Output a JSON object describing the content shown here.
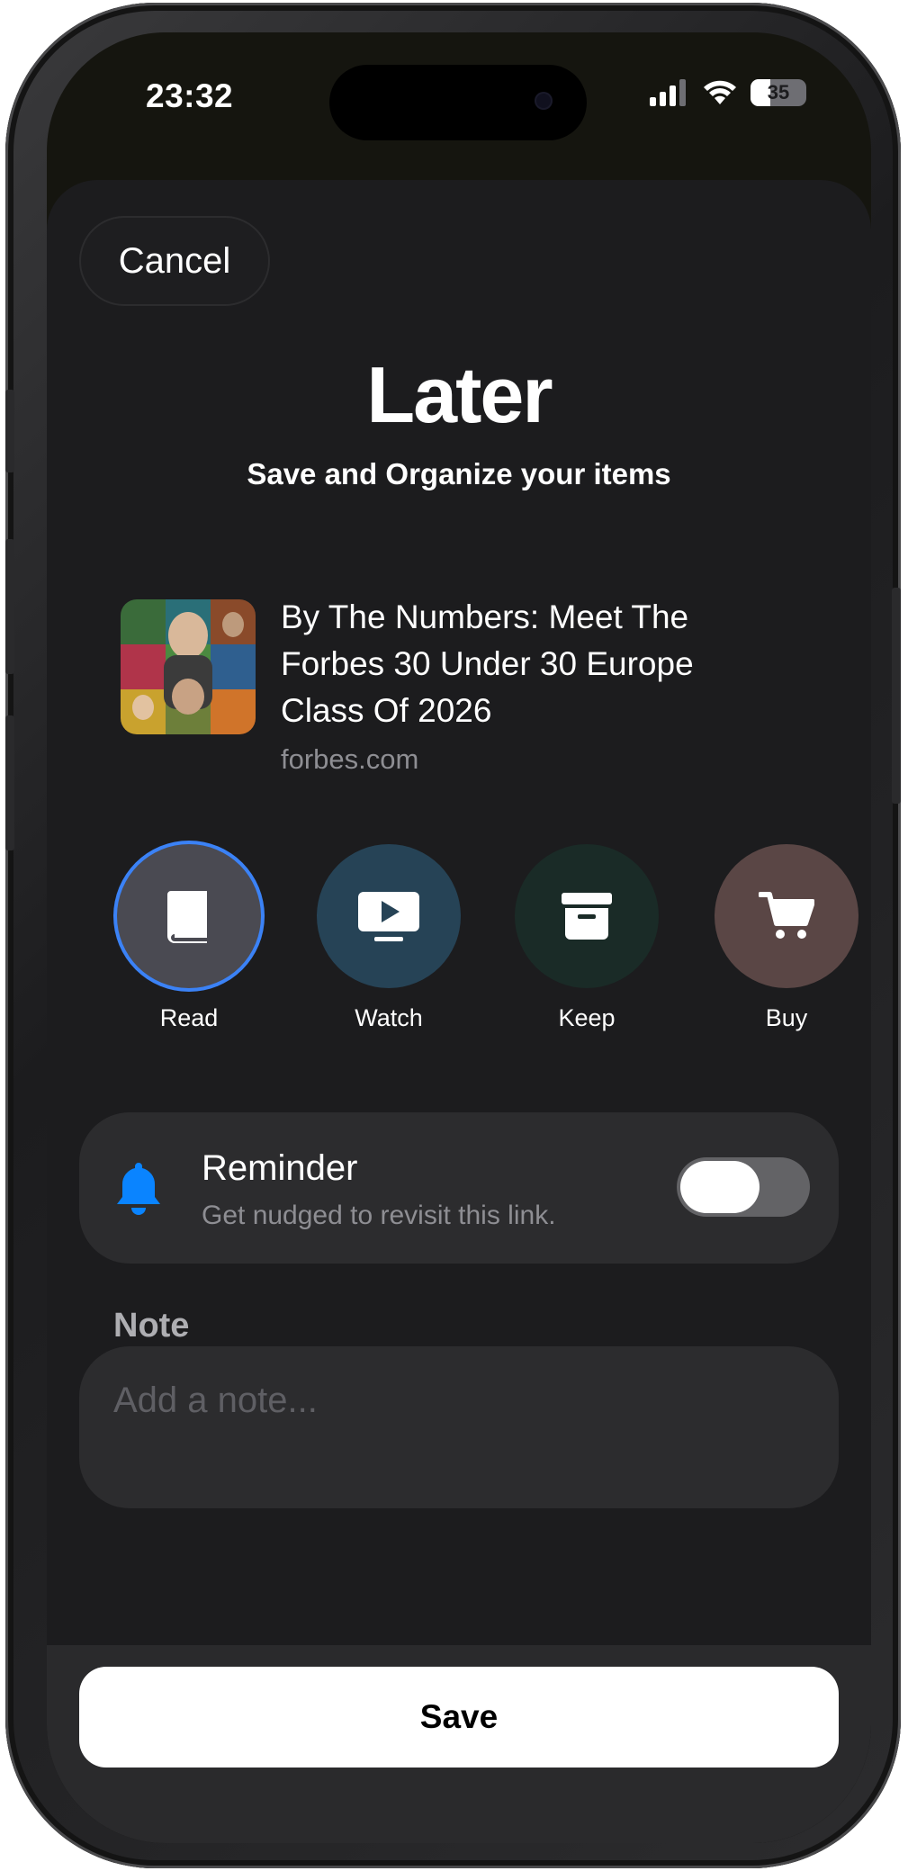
{
  "status_bar": {
    "time": "23:32",
    "battery": "35",
    "battery_level": 0.35
  },
  "sheet": {
    "cancel_label": "Cancel",
    "app_title": "Later",
    "subtitle": "Save and Organize your items"
  },
  "article": {
    "title": "By The Numbers: Meet The Forbes 30 Under 30 Europe Class Of 2026",
    "source": "forbes.com"
  },
  "categories": [
    {
      "label": "Read",
      "icon": "book-icon",
      "color": "#4a4a52",
      "selected": true
    },
    {
      "label": "Watch",
      "icon": "play-screen-icon",
      "color": "#264356"
    },
    {
      "label": "Keep",
      "icon": "archive-box-icon",
      "color": "#1a2b27"
    },
    {
      "label": "Buy",
      "icon": "cart-icon",
      "color": "#5a4645"
    }
  ],
  "reminder": {
    "title": "Reminder",
    "subtitle": "Get nudged to revisit this link.",
    "enabled": false,
    "bell_color": "#0a84ff"
  },
  "note": {
    "label": "Note",
    "placeholder": "Add a note...",
    "value": ""
  },
  "footer": {
    "save_label": "Save"
  },
  "colors": {
    "accent": "#3b82f6",
    "sheet_bg": "#1c1c1e",
    "card_bg": "#2c2c2e"
  }
}
